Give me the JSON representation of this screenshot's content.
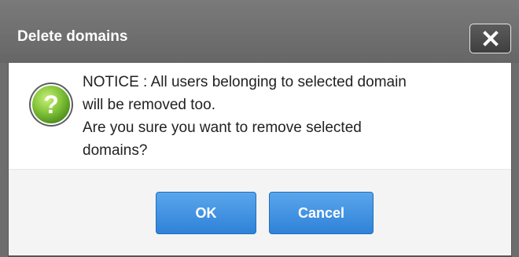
{
  "dialog": {
    "title": "Delete domains",
    "close_icon": "close-x-icon",
    "help_icon": "question-mark-icon",
    "message_lines": [
      "NOTICE : All users belonging to selected domain",
      "will be removed too.",
      "Are you sure you want to remove selected",
      "domains?"
    ],
    "buttons": {
      "ok_label": "OK",
      "cancel_label": "Cancel"
    }
  },
  "colors": {
    "titlebar": "#6d6d6d",
    "button_primary": "#3a8de0",
    "help_icon_green": "#7fbf3a"
  }
}
